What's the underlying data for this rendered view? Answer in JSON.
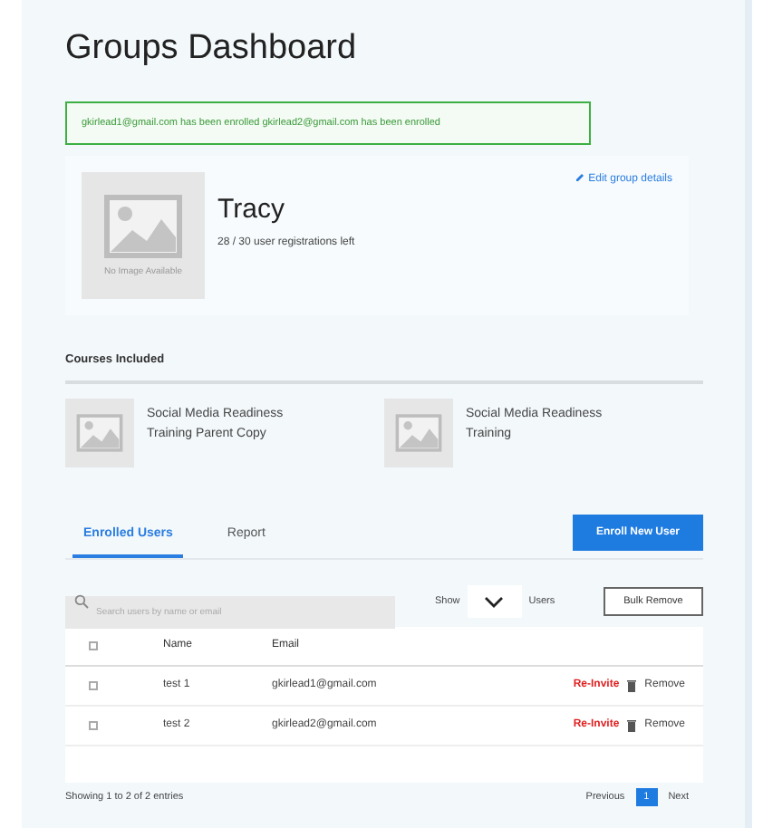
{
  "title": "Groups Dashboard",
  "alert": "gkirlead1@gmail.com has been enrolled gkirlead2@gmail.com has been enrolled",
  "group": {
    "image_caption": "No Image Available",
    "name": "Tracy",
    "registrations": "28 / 30 user registrations left",
    "edit_link": "Edit group details"
  },
  "courses": {
    "heading": "Courses Included",
    "items": [
      {
        "title": "Social Media Readiness Training Parent Copy"
      },
      {
        "title": "Social Media Readiness Training"
      }
    ]
  },
  "tabs": [
    {
      "label": "Enrolled Users",
      "selected": true
    },
    {
      "label": "Report",
      "selected": false
    }
  ],
  "enroll_button": "Enroll New User",
  "search": {
    "placeholder": "Search users by name or email"
  },
  "show_label": "Show",
  "users_label": "Users",
  "bulk_remove": "Bulk Remove",
  "table": {
    "header_checked": false,
    "columns": [
      "Name",
      "Email"
    ],
    "rows": [
      {
        "checked": false,
        "name": "test 1",
        "email": "gkirlead1@gmail.com",
        "reinvite": "Re-Invite",
        "remove": "Remove"
      },
      {
        "checked": false,
        "name": "test 2",
        "email": "gkirlead2@gmail.com",
        "reinvite": "Re-Invite",
        "remove": "Remove"
      }
    ]
  },
  "footer": {
    "summary": "Showing 1 to 2 of 2 entries",
    "previous": "Previous",
    "pages": [
      {
        "label": "1",
        "selected": true
      }
    ],
    "next": "Next"
  }
}
